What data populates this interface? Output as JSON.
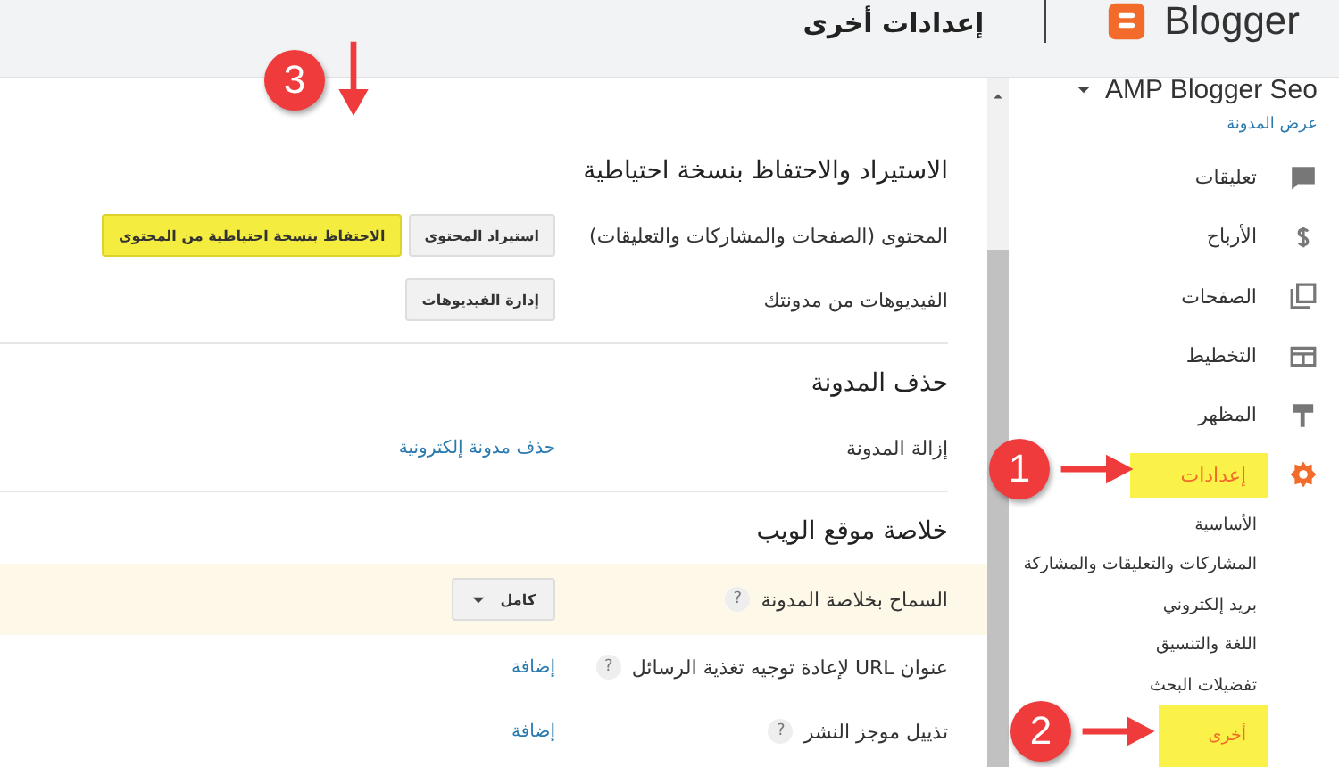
{
  "header": {
    "app_name": "Blogger",
    "title": "إعدادات أخرى"
  },
  "sidebar": {
    "blog_name": "AMP Blogger Seo",
    "view_blog": "عرض المدونة",
    "items": [
      {
        "label": "تعليقات",
        "kind": "comment",
        "selected": false,
        "highlighted": false
      },
      {
        "label": "الأرباح",
        "kind": "dollar",
        "selected": false,
        "highlighted": false
      },
      {
        "label": "الصفحات",
        "kind": "pages",
        "selected": false,
        "highlighted": false
      },
      {
        "label": "التخطيط",
        "kind": "layout",
        "selected": false,
        "highlighted": false
      },
      {
        "label": "المظهر",
        "kind": "theme",
        "selected": false,
        "highlighted": false
      },
      {
        "label": "إعدادات",
        "kind": "gear",
        "selected": true,
        "highlighted": true,
        "children": [
          {
            "label": "الأساسية",
            "selected": false,
            "highlighted": false
          },
          {
            "label": "المشاركات والتعليقات والمشاركة",
            "selected": false,
            "highlighted": false
          },
          {
            "label": "بريد إلكتروني",
            "selected": false,
            "highlighted": false
          },
          {
            "label": "اللغة والتنسيق",
            "selected": false,
            "highlighted": false
          },
          {
            "label": "تفضيلات البحث",
            "selected": false,
            "highlighted": false
          },
          {
            "label": "أخرى",
            "selected": true,
            "highlighted": true
          }
        ]
      }
    ]
  },
  "sections": [
    {
      "title": "الاستيراد والاحتفاظ بنسخة احتياطية",
      "rows": [
        {
          "label": "المحتوى (الصفحات والمشاركات والتعليقات)",
          "highlighted": false,
          "controls": [
            {
              "kind": "button",
              "label": "استيراد المحتوى",
              "highlighted": false
            },
            {
              "kind": "button",
              "label": "الاحتفاظ بنسخة احتياطية من المحتوى",
              "highlighted": true
            }
          ]
        },
        {
          "label": "الفيديوهات من مدونتك",
          "highlighted": false,
          "controls": [
            {
              "kind": "button",
              "label": "إدارة الفيديوهات",
              "highlighted": false
            }
          ]
        }
      ]
    },
    {
      "title": "حذف المدونة",
      "rows": [
        {
          "label": "إزالة المدونة",
          "highlighted": false,
          "controls": [
            {
              "kind": "link",
              "label": "حذف مدونة إلكترونية"
            }
          ]
        }
      ]
    },
    {
      "title": "خلاصة موقع الويب",
      "rows": [
        {
          "label": "السماح بخلاصة المدونة",
          "help": "?",
          "highlighted": true,
          "controls": [
            {
              "kind": "dropdown",
              "label": "كامل"
            }
          ]
        },
        {
          "label": "عنوان URL لإعادة توجيه تغذية الرسائل",
          "help": "?",
          "highlighted": false,
          "controls": [
            {
              "kind": "link",
              "label": "إضافة"
            }
          ]
        },
        {
          "label": "تذييل موجز النشر",
          "help": "?",
          "highlighted": false,
          "controls": [
            {
              "kind": "link",
              "label": "إضافة"
            }
          ]
        }
      ]
    }
  ],
  "annotations": [
    {
      "number": "3"
    },
    {
      "number": "1"
    },
    {
      "number": "2"
    }
  ]
}
